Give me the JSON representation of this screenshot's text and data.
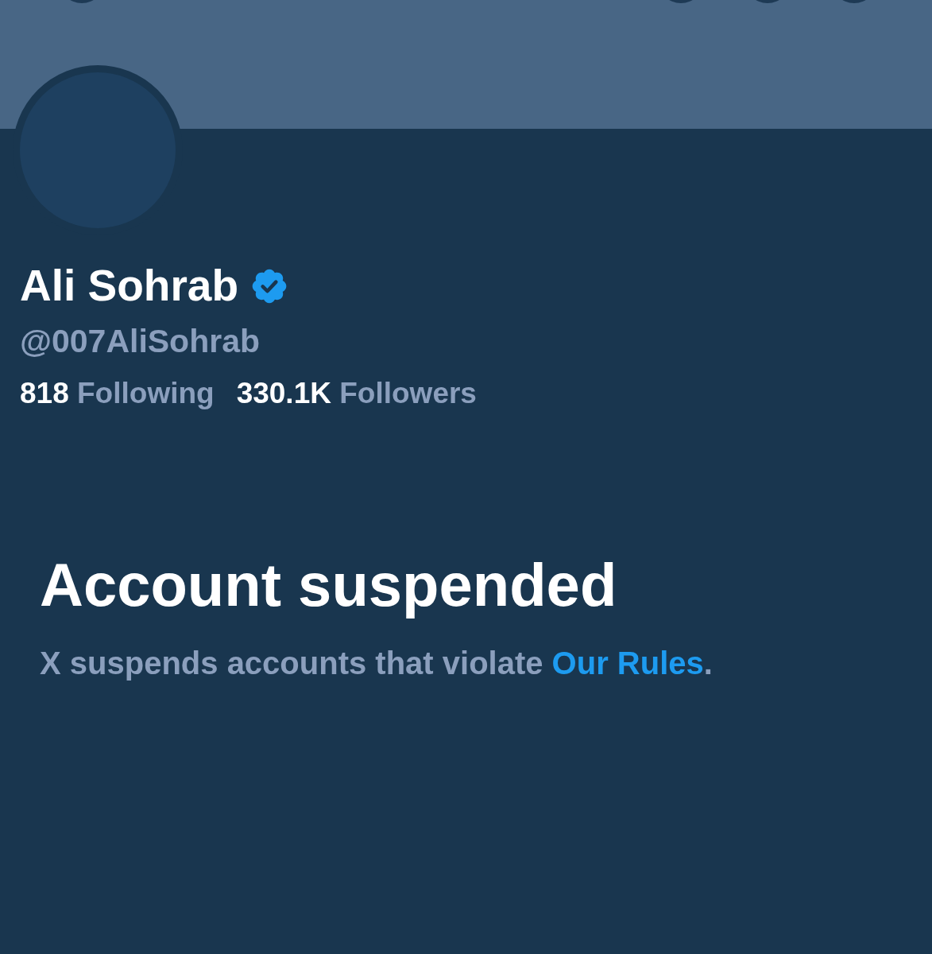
{
  "profile": {
    "name": "Ali Sohrab",
    "verified": true,
    "handle": "@007AliSohrab",
    "stats": [
      {
        "count": "818",
        "label": "Following"
      },
      {
        "count": "330.1K",
        "label": "Followers"
      }
    ]
  },
  "notice": {
    "title": "Account suspended",
    "text_before": "X suspends accounts that violate ",
    "link": "Our Rules",
    "text_after": "."
  }
}
